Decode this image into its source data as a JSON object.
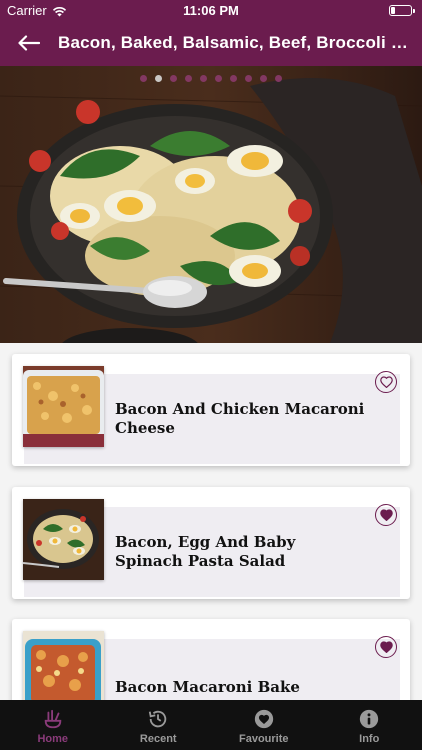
{
  "status": {
    "carrier": "Carrier",
    "time": "11:06 PM"
  },
  "header": {
    "title": "Bacon, Baked, Balsamic, Beef, Broccoli P..."
  },
  "carousel": {
    "page_count": 10,
    "active_index": 1
  },
  "recipes": [
    {
      "title": "Bacon And Chicken Macaroni Cheese",
      "favourite": false
    },
    {
      "title": "Bacon, Egg And Baby Spinach Pasta Salad",
      "favourite": true
    },
    {
      "title": "Bacon Macaroni Bake",
      "favourite": true
    }
  ],
  "tabs": [
    {
      "label": "Home",
      "icon": "home-icon",
      "active": true
    },
    {
      "label": "Recent",
      "icon": "recent-icon",
      "active": false
    },
    {
      "label": "Favourite",
      "icon": "favourite-icon",
      "active": false
    },
    {
      "label": "Info",
      "icon": "info-icon",
      "active": false
    }
  ],
  "colors": {
    "brand": "#6b1c4e",
    "tab_active": "#8a3b7a",
    "tabbar_bg": "#111111"
  }
}
